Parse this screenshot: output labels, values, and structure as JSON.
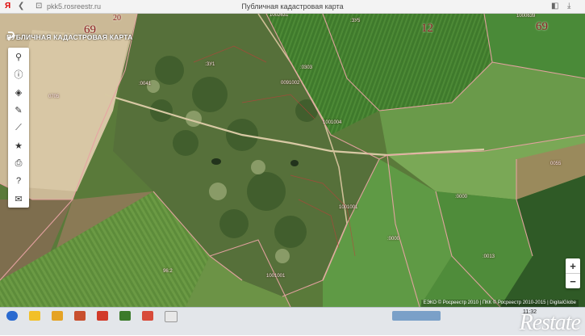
{
  "browser": {
    "url": "pkk5.rosreestr.ru",
    "page_title": "Публичная кадастровая карта",
    "icons": [
      "yandex-logo-icon",
      "back-icon",
      "lock-icon",
      "bookmark-icon",
      "download-icon"
    ]
  },
  "app": {
    "brand_title": "ПУБЛИЧНАЯ КАДАСТРОВАЯ КАРТА"
  },
  "toolbar": [
    {
      "name": "search",
      "glyph": "⚲"
    },
    {
      "name": "info",
      "glyph": "ⓘ"
    },
    {
      "name": "layers",
      "glyph": "◈"
    },
    {
      "name": "draw",
      "glyph": "✎"
    },
    {
      "name": "measure",
      "glyph": "⟋"
    },
    {
      "name": "favorites",
      "glyph": "★"
    },
    {
      "name": "print",
      "glyph": "⎙"
    },
    {
      "name": "help",
      "glyph": "?"
    },
    {
      "name": "mail",
      "glyph": "✉"
    }
  ],
  "map": {
    "large_labels": [
      "69",
      "12",
      "69",
      "20"
    ],
    "cadastral_labels": [
      "1002631",
      ":ЗУ1",
      "1000639",
      ":ЗУ5",
      "0091002",
      ":0303",
      "1001004",
      "0705",
      ":0041",
      "0055",
      "1001001",
      ":0000",
      "1001001",
      ":0000",
      ":0013",
      "96:2"
    ],
    "zoom_in": "+",
    "zoom_out": "−",
    "copyright": "ЕЭКО © Росреестр 2010 | ПКК © Росреестр 2010-2015 | DigitalGlobe"
  },
  "taskbar": {
    "time": "11:32",
    "watermark": "Restate"
  }
}
